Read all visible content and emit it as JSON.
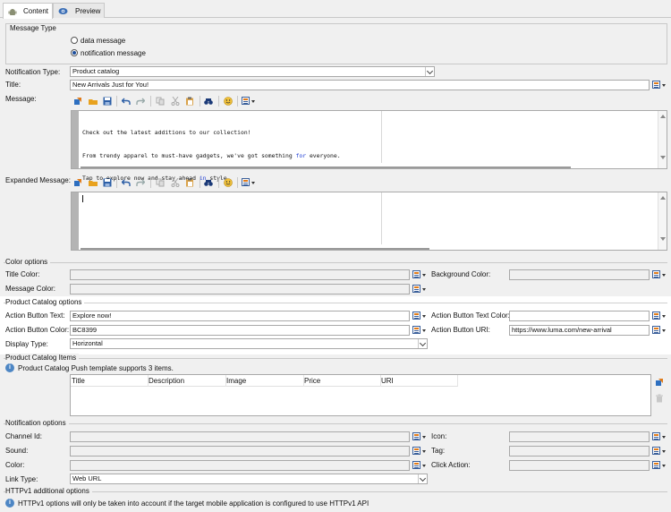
{
  "tabs": [
    {
      "label": "Content",
      "icon": "android-icon",
      "active": true
    },
    {
      "label": "Preview",
      "icon": "eye-icon",
      "active": false
    }
  ],
  "message_type": {
    "label": "Message Type",
    "options": [
      "data message",
      "notification message"
    ],
    "selected": "notification message"
  },
  "fields": {
    "notification_type": {
      "label": "Notification Type:",
      "value": "Product catalog"
    },
    "title": {
      "label": "Title:",
      "value": "New Arrivals Just for You!"
    },
    "message": {
      "label": "Message:",
      "lines": [
        [
          "Check out the latest additions to our collection!"
        ],
        [
          "From trendy apparel to must-have gadgets, we've got something ",
          "for",
          " everyone."
        ],
        [
          "Tap to explore now and stay ahead ",
          "in",
          " style."
        ]
      ]
    },
    "expanded_message": {
      "label": "Expanded Message:"
    }
  },
  "color_options": {
    "section": "Color options",
    "title_color": "Title Color:",
    "background_color": "Background Color:",
    "message_color": "Message Color:"
  },
  "product_catalog_options": {
    "section": "Product Catalog options",
    "action_button_text": {
      "label": "Action Button Text:",
      "value": "Explore now!"
    },
    "action_button_text_color": {
      "label": "Action Button Text Color:",
      "value": ""
    },
    "action_button_color": {
      "label": "Action Button Color:",
      "value": "BC8399"
    },
    "action_button_uri": {
      "label": "Action Button URI:",
      "value": "https://www.luma.com/new-arrival"
    },
    "display_type": {
      "label": "Display Type:",
      "value": "Horizontal"
    }
  },
  "product_catalog_items": {
    "section": "Product Catalog Items",
    "info": "Product Catalog Push template supports 3 items.",
    "columns": [
      "Title",
      "Description",
      "Image",
      "Price",
      "URI"
    ]
  },
  "notification_options": {
    "section": "Notification options",
    "channel_id": "Channel Id:",
    "icon": "Icon:",
    "sound": "Sound:",
    "tag": "Tag:",
    "color": "Color:",
    "click_action": "Click Action:",
    "link_type": {
      "label": "Link Type:",
      "value": "Web URL"
    }
  },
  "httpv1": {
    "section": "HTTPv1 additional options",
    "info": "HTTPv1 options will only be taken into account if the target mobile application is configured to use HTTPv1 API"
  },
  "colors": {
    "accent": "#1d4e9c",
    "keyword": "#1f3fd6",
    "field_border": "#a9a9a9"
  }
}
